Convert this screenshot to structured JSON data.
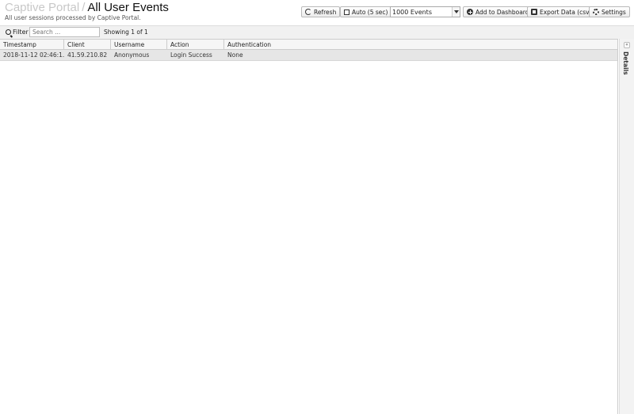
{
  "header": {
    "breadcrumb_parent": "Captive Portal",
    "separator": "/",
    "title": "All User Events",
    "subtitle": "All user sessions processed by Captive Portal."
  },
  "actions": {
    "refresh_label": "Refresh",
    "auto_label": "Auto (5 sec)",
    "events_select_value": "1000 Events",
    "add_dashboard_label": "Add to Dashboard",
    "export_label": "Export Data (csv)",
    "settings_label": "Settings"
  },
  "toolbar": {
    "filter_label": "Filter",
    "search_placeholder": "Search ...",
    "showing_text": "Showing 1 of 1"
  },
  "table": {
    "columns": [
      "Timestamp",
      "Client",
      "Username",
      "Action",
      "Authentication"
    ],
    "rows": [
      [
        "2018-11-12 02:46:1...",
        "41.59.210.82",
        "Anonymous",
        "Login Success",
        "None"
      ]
    ]
  },
  "details_panel": {
    "label": "Details",
    "toggle_glyph": "«"
  }
}
